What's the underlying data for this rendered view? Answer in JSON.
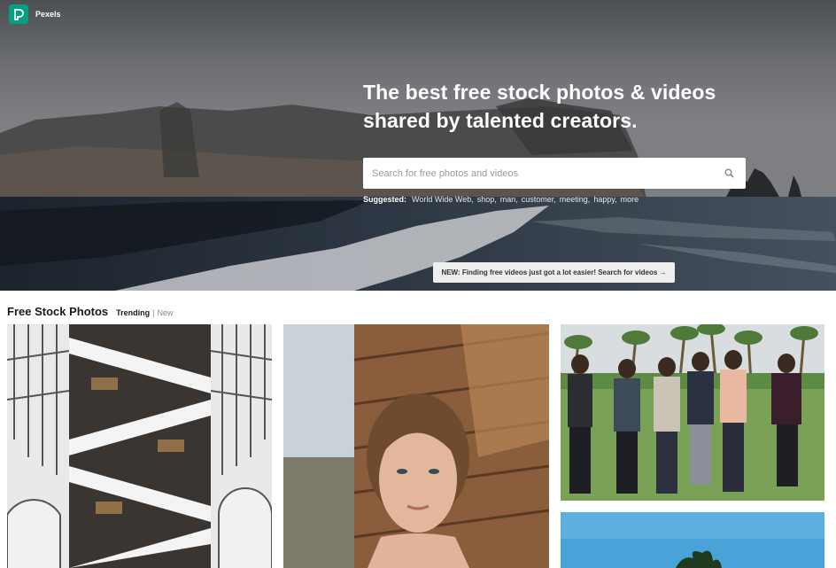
{
  "brand": {
    "name": "Pexels",
    "logo_icon": "pexels-logo-icon",
    "logo_color": "#05a081"
  },
  "hero": {
    "headline": "The best free stock photos & videos shared by talented creators.",
    "search": {
      "placeholder": "Search for free photos and videos",
      "value": "",
      "icon": "search-icon"
    },
    "suggested": {
      "label": "Suggested:",
      "items": [
        "World Wide Web,",
        "shop,",
        "man,",
        "customer,",
        "meeting,",
        "happy,",
        "more"
      ]
    },
    "notice": "NEW: Finding free videos just got a lot easier! Search for videos →"
  },
  "section": {
    "title": "Free Stock Photos",
    "filters": {
      "trending": "Trending",
      "separator": "|",
      "new": "New"
    }
  },
  "photos": [
    {
      "subject": "escalators-architecture"
    },
    {
      "subject": "woman-portrait"
    },
    {
      "subject": "group-of-men-laughing"
    },
    {
      "subject": "palm-tree-sky"
    }
  ]
}
